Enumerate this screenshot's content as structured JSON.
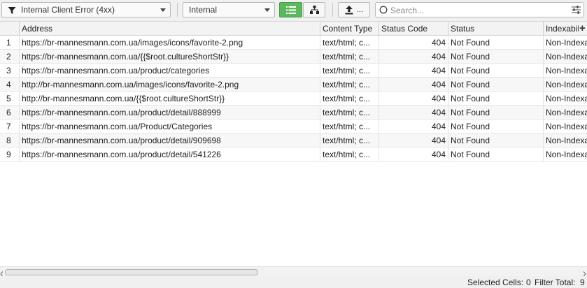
{
  "toolbar": {
    "filter_value": "Internal Client Error (4xx)",
    "tab_filter_value": "Internal",
    "export_label": "...",
    "search_placeholder": "Search...",
    "list_view_color": "#5cb85c"
  },
  "columns": [
    "Address",
    "Content Type",
    "Status Code",
    "Status",
    "Indexabil"
  ],
  "add_column_label": "+",
  "rows": [
    {
      "n": "1",
      "address": "https://br-mannesmann.com.ua/images/icons/favorite-2.png",
      "content_type": "text/html; c...",
      "status_code": "404",
      "status": "Not Found",
      "indexability": "Non-Indexa"
    },
    {
      "n": "2",
      "address": "https://br-mannesmann.com.ua/{{$root.cultureShortStr}}",
      "content_type": "text/html; c...",
      "status_code": "404",
      "status": "Not Found",
      "indexability": "Non-Indexa"
    },
    {
      "n": "3",
      "address": "https://br-mannesmann.com.ua/product/categories",
      "content_type": "text/html; c...",
      "status_code": "404",
      "status": "Not Found",
      "indexability": "Non-Indexa"
    },
    {
      "n": "4",
      "address": "http://br-mannesmann.com.ua/images/icons/favorite-2.png",
      "content_type": "text/html; c...",
      "status_code": "404",
      "status": "Not Found",
      "indexability": "Non-Indexa"
    },
    {
      "n": "5",
      "address": "http://br-mannesmann.com.ua/{{$root.cultureShortStr}}",
      "content_type": "text/html; c...",
      "status_code": "404",
      "status": "Not Found",
      "indexability": "Non-Indexa"
    },
    {
      "n": "6",
      "address": "https://br-mannesmann.com.ua/product/detail/888999",
      "content_type": "text/html; c...",
      "status_code": "404",
      "status": "Not Found",
      "indexability": "Non-Indexa"
    },
    {
      "n": "7",
      "address": "https://br-mannesmann.com.ua/Product/Categories",
      "content_type": "text/html; c...",
      "status_code": "404",
      "status": "Not Found",
      "indexability": "Non-Indexa"
    },
    {
      "n": "8",
      "address": "https://br-mannesmann.com.ua/product/detail/909698",
      "content_type": "text/html; c...",
      "status_code": "404",
      "status": "Not Found",
      "indexability": "Non-Indexa"
    },
    {
      "n": "9",
      "address": "https://br-mannesmann.com.ua/product/detail/541226",
      "content_type": "text/html; c...",
      "status_code": "404",
      "status": "Not Found",
      "indexability": "Non-Indexa"
    }
  ],
  "status_bar": {
    "selected_label": "Selected Cells:",
    "selected_value": "0",
    "filter_label": "Filter Total:",
    "filter_value": "9"
  }
}
